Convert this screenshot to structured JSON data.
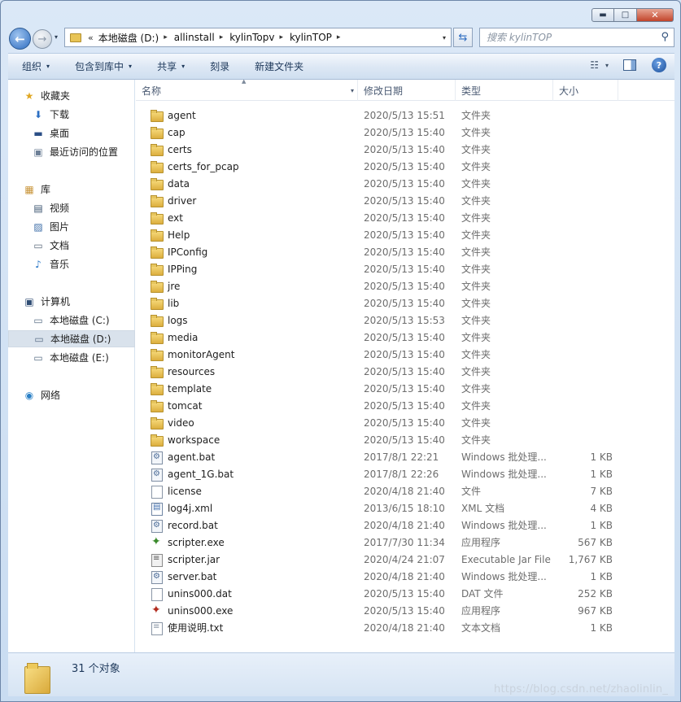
{
  "window": {
    "min_label": "▬",
    "max_label": "□",
    "close_label": "✕"
  },
  "nav": {
    "back_glyph": "←",
    "forward_glyph": "→",
    "dropdown_glyph": "▾"
  },
  "address": {
    "overflow": "«",
    "segments": [
      "本地磁盘 (D:)",
      "allinstall",
      "kylinTopv",
      "kylinTOP"
    ],
    "sep_glyph": "▸",
    "dropdown_glyph": "▾"
  },
  "search": {
    "placeholder": "搜索 kylinTOP",
    "icon": "search-icon"
  },
  "toolbar": {
    "items": [
      {
        "label": "组织",
        "dropdown": true
      },
      {
        "label": "包含到库中",
        "dropdown": true
      },
      {
        "label": "共享",
        "dropdown": true
      },
      {
        "label": "刻录",
        "dropdown": false
      },
      {
        "label": "新建文件夹",
        "dropdown": false
      }
    ],
    "view_glyph": "☷",
    "help_label": "?"
  },
  "sidebar": {
    "favorites": "收藏夹",
    "fav_items": [
      "下载",
      "桌面",
      "最近访问的位置"
    ],
    "libraries": "库",
    "lib_items": [
      "视频",
      "图片",
      "文档",
      "音乐"
    ],
    "computer": "计算机",
    "drives": [
      "本地磁盘 (C:)",
      "本地磁盘 (D:)",
      "本地磁盘 (E:)"
    ],
    "network": "网络"
  },
  "columns": {
    "name": "名称",
    "date": "修改日期",
    "type": "类型",
    "size": "大小"
  },
  "files": [
    {
      "name": "agent",
      "date": "2020/5/13 15:51",
      "type": "文件夹",
      "size": "",
      "icon": "folder"
    },
    {
      "name": "cap",
      "date": "2020/5/13 15:40",
      "type": "文件夹",
      "size": "",
      "icon": "folder"
    },
    {
      "name": "certs",
      "date": "2020/5/13 15:40",
      "type": "文件夹",
      "size": "",
      "icon": "folder"
    },
    {
      "name": "certs_for_pcap",
      "date": "2020/5/13 15:40",
      "type": "文件夹",
      "size": "",
      "icon": "folder"
    },
    {
      "name": "data",
      "date": "2020/5/13 15:40",
      "type": "文件夹",
      "size": "",
      "icon": "folder"
    },
    {
      "name": "driver",
      "date": "2020/5/13 15:40",
      "type": "文件夹",
      "size": "",
      "icon": "folder"
    },
    {
      "name": "ext",
      "date": "2020/5/13 15:40",
      "type": "文件夹",
      "size": "",
      "icon": "folder"
    },
    {
      "name": "Help",
      "date": "2020/5/13 15:40",
      "type": "文件夹",
      "size": "",
      "icon": "folder"
    },
    {
      "name": "IPConfig",
      "date": "2020/5/13 15:40",
      "type": "文件夹",
      "size": "",
      "icon": "folder"
    },
    {
      "name": "IPPing",
      "date": "2020/5/13 15:40",
      "type": "文件夹",
      "size": "",
      "icon": "folder"
    },
    {
      "name": "jre",
      "date": "2020/5/13 15:40",
      "type": "文件夹",
      "size": "",
      "icon": "folder"
    },
    {
      "name": "lib",
      "date": "2020/5/13 15:40",
      "type": "文件夹",
      "size": "",
      "icon": "folder"
    },
    {
      "name": "logs",
      "date": "2020/5/13 15:53",
      "type": "文件夹",
      "size": "",
      "icon": "folder"
    },
    {
      "name": "media",
      "date": "2020/5/13 15:40",
      "type": "文件夹",
      "size": "",
      "icon": "folder"
    },
    {
      "name": "monitorAgent",
      "date": "2020/5/13 15:40",
      "type": "文件夹",
      "size": "",
      "icon": "folder"
    },
    {
      "name": "resources",
      "date": "2020/5/13 15:40",
      "type": "文件夹",
      "size": "",
      "icon": "folder"
    },
    {
      "name": "template",
      "date": "2020/5/13 15:40",
      "type": "文件夹",
      "size": "",
      "icon": "folder"
    },
    {
      "name": "tomcat",
      "date": "2020/5/13 15:40",
      "type": "文件夹",
      "size": "",
      "icon": "folder"
    },
    {
      "name": "video",
      "date": "2020/5/13 15:40",
      "type": "文件夹",
      "size": "",
      "icon": "folder"
    },
    {
      "name": "workspace",
      "date": "2020/5/13 15:40",
      "type": "文件夹",
      "size": "",
      "icon": "folder"
    },
    {
      "name": "agent.bat",
      "date": "2017/8/1 22:21",
      "type": "Windows 批处理...",
      "size": "1 KB",
      "icon": "bat"
    },
    {
      "name": "agent_1G.bat",
      "date": "2017/8/1 22:26",
      "type": "Windows 批处理...",
      "size": "1 KB",
      "icon": "bat"
    },
    {
      "name": "license",
      "date": "2020/4/18 21:40",
      "type": "文件",
      "size": "7 KB",
      "icon": "doc"
    },
    {
      "name": "log4j.xml",
      "date": "2013/6/15 18:10",
      "type": "XML 文档",
      "size": "4 KB",
      "icon": "xml"
    },
    {
      "name": "record.bat",
      "date": "2020/4/18 21:40",
      "type": "Windows 批处理...",
      "size": "1 KB",
      "icon": "bat"
    },
    {
      "name": "scripter.exe",
      "date": "2017/7/30 11:34",
      "type": "应用程序",
      "size": "567 KB",
      "icon": "exe"
    },
    {
      "name": "scripter.jar",
      "date": "2020/4/24 21:07",
      "type": "Executable Jar File",
      "size": "1,767 KB",
      "icon": "jar"
    },
    {
      "name": "server.bat",
      "date": "2020/4/18 21:40",
      "type": "Windows 批处理...",
      "size": "1 KB",
      "icon": "bat"
    },
    {
      "name": "unins000.dat",
      "date": "2020/5/13 15:40",
      "type": "DAT 文件",
      "size": "252 KB",
      "icon": "doc"
    },
    {
      "name": "unins000.exe",
      "date": "2020/5/13 15:40",
      "type": "应用程序",
      "size": "967 KB",
      "icon": "exe2"
    },
    {
      "name": "使用说明.txt",
      "date": "2020/4/18 21:40",
      "type": "文本文档",
      "size": "1 KB",
      "icon": "txt"
    }
  ],
  "status": {
    "count_text": "31 个对象"
  },
  "watermark": "https://blog.csdn.net/zhaolinlin_"
}
